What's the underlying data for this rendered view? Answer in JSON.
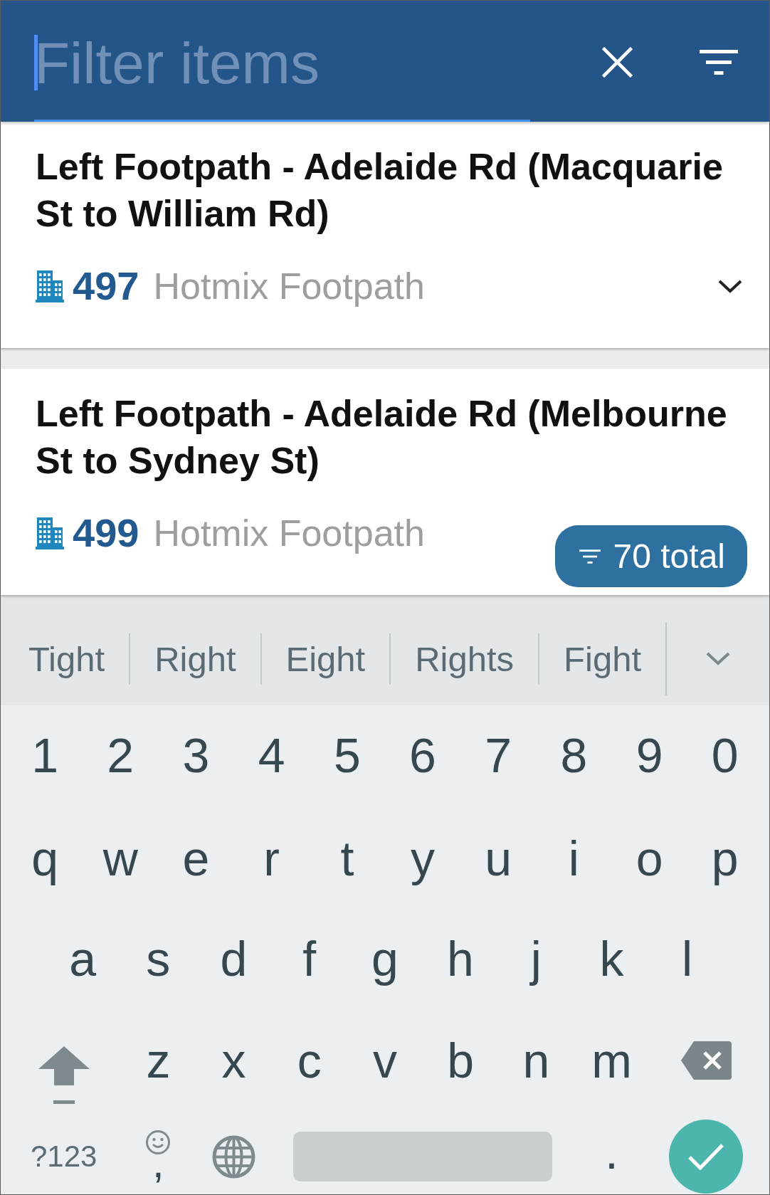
{
  "search": {
    "placeholder": "Filter items",
    "focused": true
  },
  "items": [
    {
      "title": "Left Footpath - Adelaide Rd (Macquarie St to William Rd)",
      "number": "497",
      "category": "Hotmix Footpath",
      "chevron_visible": true
    },
    {
      "title": "Left Footpath - Adelaide Rd (Melbourne St to Sydney St)",
      "number": "499",
      "category": "Hotmix Footpath",
      "chevron_visible": false
    }
  ],
  "total_badge": {
    "label": "70 total"
  },
  "keyboard": {
    "suggestions": [
      "Tight",
      "Right",
      "Eight",
      "Rights",
      "Fight"
    ],
    "number_row": [
      "1",
      "2",
      "3",
      "4",
      "5",
      "6",
      "7",
      "8",
      "9",
      "0"
    ],
    "letter_rows": [
      [
        "q",
        "w",
        "e",
        "r",
        "t",
        "y",
        "u",
        "i",
        "o",
        "p"
      ],
      [
        "a",
        "s",
        "d",
        "f",
        "g",
        "h",
        "j",
        "k",
        "l"
      ],
      [
        "z",
        "x",
        "c",
        "v",
        "b",
        "n",
        "m"
      ]
    ],
    "symbols_key": "?123",
    "comma_key": ",",
    "period_key": "."
  }
}
